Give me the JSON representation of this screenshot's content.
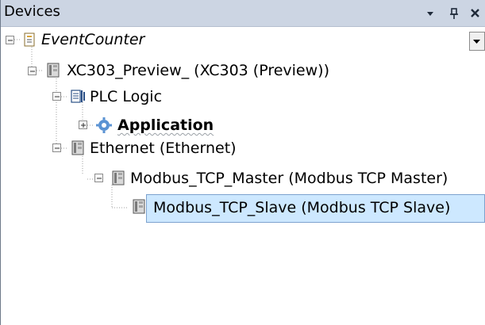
{
  "panel": {
    "title": "Devices",
    "dropdown_glyph": "▾",
    "pin_glyph": "ᵖ",
    "close_glyph": "✕",
    "scroll_dropdown_glyph": "▾"
  },
  "tree": {
    "nodes": [
      {
        "label": "EventCounter",
        "icon": "project-file-icon",
        "expanded": true
      },
      {
        "label": "XC303_Preview_ (XC303 (Preview))",
        "icon": "device-icon",
        "expanded": true
      },
      {
        "label": "PLC Logic",
        "icon": "plc-logic-icon",
        "expanded": true
      },
      {
        "label": "Application",
        "icon": "application-gear-icon",
        "expanded": false
      },
      {
        "label": "Ethernet (Ethernet)",
        "icon": "device-icon",
        "expanded": true
      },
      {
        "label": "Modbus_TCP_Master (Modbus TCP Master)",
        "icon": "device-icon",
        "expanded": true
      },
      {
        "label": "Modbus_TCP_Slave (Modbus TCP Slave)",
        "icon": "device-icon",
        "selected": true
      }
    ]
  },
  "colors": {
    "titlebar": "#ccd5e3",
    "selection": "#cde8ff",
    "selection_border": "#7da2ce",
    "gear": "#5b93d3"
  }
}
